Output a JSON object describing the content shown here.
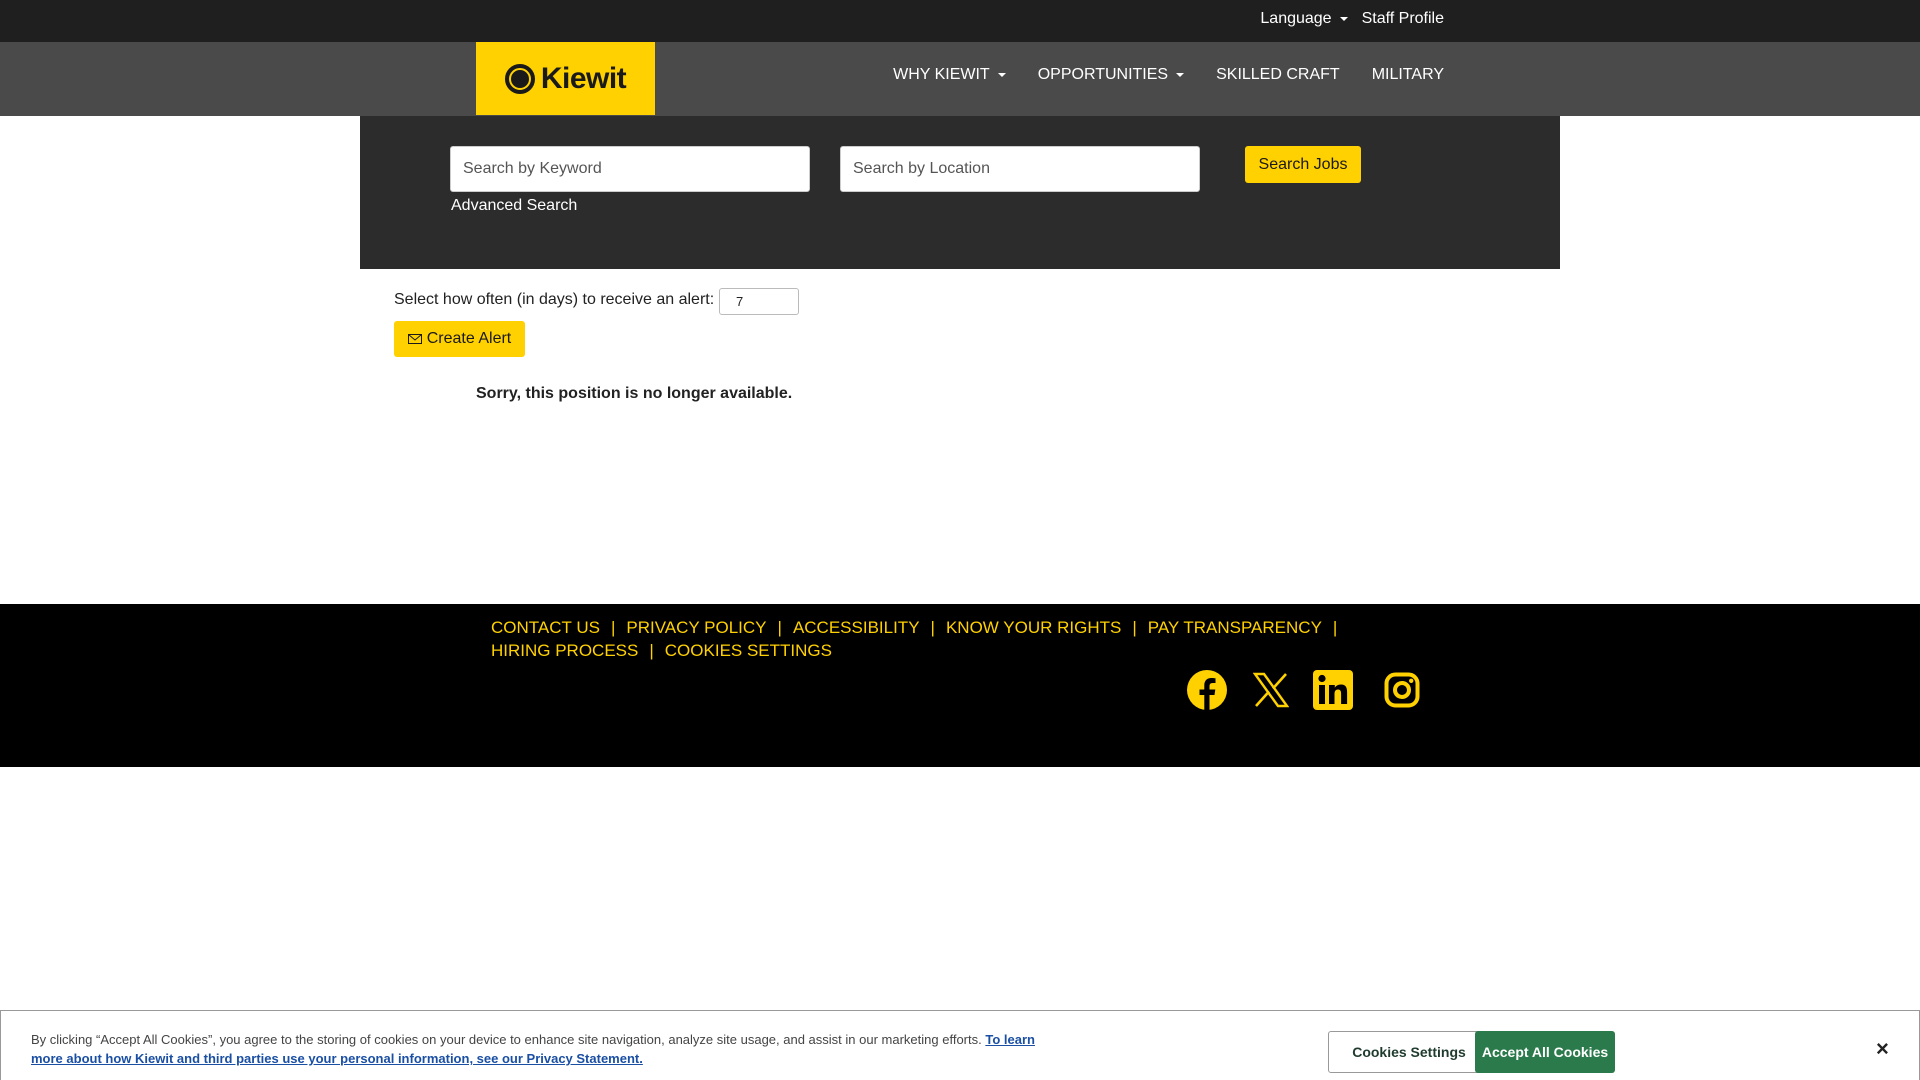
{
  "topbar": {
    "language_label": "Language",
    "staff_profile_label": "Staff Profile"
  },
  "logo": {
    "text": "Kiewit"
  },
  "nav": {
    "items": [
      {
        "label": "WHY KIEWIT",
        "dropdown": true
      },
      {
        "label": "OPPORTUNITIES",
        "dropdown": true
      },
      {
        "label": "SKILLED CRAFT",
        "dropdown": false
      },
      {
        "label": "MILITARY",
        "dropdown": false
      }
    ]
  },
  "search": {
    "keyword_placeholder": "Search by Keyword",
    "location_placeholder": "Search by Location",
    "advanced_label": "Advanced Search",
    "button_label": "Search Jobs"
  },
  "alert": {
    "label": "Select how often (in days) to receive an alert:",
    "value": "7",
    "button_label": "Create Alert"
  },
  "message": "Sorry, this position is no longer available.",
  "footer": {
    "row1": [
      "CONTACT US",
      "PRIVACY POLICY",
      "ACCESSIBILITY",
      "KNOW YOUR RIGHTS",
      "PAY TRANSPARENCY"
    ],
    "row2": [
      "HIRING PROCESS",
      "COOKIES SETTINGS"
    ],
    "separator": "|",
    "social": [
      "facebook-icon",
      "x-twitter-icon",
      "linkedin-icon",
      "instagram-icon"
    ]
  },
  "cookie": {
    "text": "By clicking “Accept All Cookies”, you agree to the storing of cookies on your device to enhance site navigation, analyze site usage, and assist in our marketing efforts.",
    "link_text": "To learn more about how Kiewit and third parties use your personal information, see our Privacy Statement.",
    "settings_label": "Cookies Settings",
    "accept_label": "Accept All Cookies",
    "close_label": "×"
  },
  "colors": {
    "brand_yellow": "#ffd100",
    "accept_green": "#2b7a4b",
    "dark": "#1f1f1f",
    "nav_gray": "#4a4a4a"
  }
}
